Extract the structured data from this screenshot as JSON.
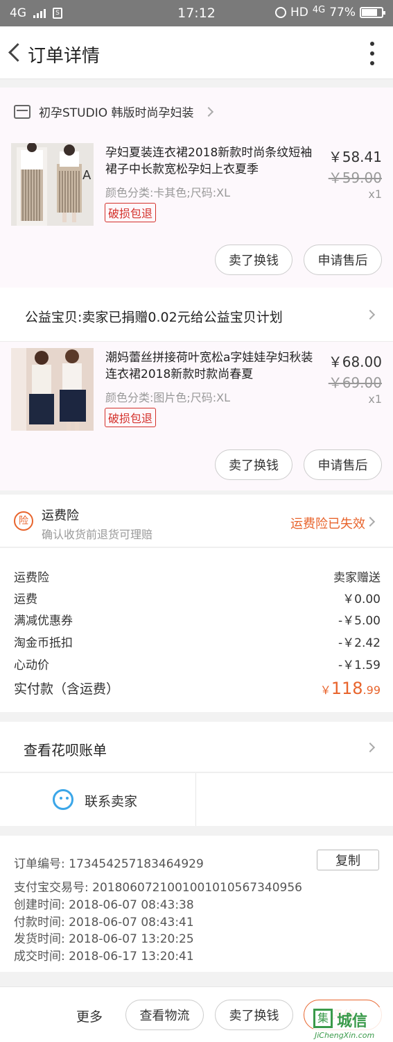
{
  "status_bar": {
    "network_left": "4G",
    "time": "17:12",
    "right_text": "HD",
    "network_right": "4G",
    "battery": "77%",
    "battery_level": 0.77
  },
  "header": {
    "title": "订单详情"
  },
  "shop": {
    "name": "初孕STUDIO 韩版时尚孕妇装"
  },
  "items": [
    {
      "title": "孕妇夏装连衣裙2018新款时尚条纹短袖裙子中长款宽松孕妇上衣夏季",
      "spec": "颜色分类:卡其色;尺码:XL",
      "tag": "破损包退",
      "price": "￥58.41",
      "orig_price": "￥59.00",
      "qty": "x1",
      "actions": [
        "卖了换钱",
        "申请售后"
      ]
    },
    {
      "title": "潮妈蕾丝拼接荷叶宽松a字娃娃孕妇秋装连衣裙2018新款时款尚春夏",
      "spec": "颜色分类:图片色;尺码:XL",
      "tag": "破损包退",
      "price": "￥68.00",
      "orig_price": "￥69.00",
      "qty": "x1",
      "actions": [
        "卖了换钱",
        "申请售后"
      ]
    }
  ],
  "charity": {
    "text": "公益宝贝:卖家已捐赠0.02元给公益宝贝计划"
  },
  "insurance": {
    "icon_text": "险",
    "title": "运费险",
    "subtitle": "确认收货前退货可理赔",
    "status": "运费险已失效"
  },
  "fees": [
    {
      "label": "运费险",
      "value": "卖家赠送"
    },
    {
      "label": "运费",
      "value": "￥0.00"
    },
    {
      "label": "满减优惠券",
      "value": "-￥5.00"
    },
    {
      "label": "淘金币抵扣",
      "value": "-￥2.42"
    },
    {
      "label": "心动价",
      "value": "-￥1.59"
    }
  ],
  "total": {
    "label": "实付款（含运费）",
    "currency": "￥",
    "int": "118",
    "dec": ".99"
  },
  "huabei": {
    "label": "查看花呗账单"
  },
  "contact": {
    "label": "联系卖家"
  },
  "order_info": {
    "order_no": "订单编号:   173454257183464929",
    "copy_label": "复制",
    "alipay_no": "支付宝交易号:   2018060721001001010567340956",
    "created": "创建时间:   2018-06-07 08:43:38",
    "paid": "付款时间:   2018-06-07 08:43:41",
    "shipped": "发货时间:   2018-06-07 13:20:25",
    "completed": "成交时间:   2018-06-17 13:20:41"
  },
  "bottom_bar": {
    "more": "更多",
    "logistics": "查看物流",
    "sell": "卖了换钱",
    "review": "评价"
  },
  "watermark": {
    "glyph": "集",
    "text": "城信",
    "url": "JiChengXin.com"
  }
}
